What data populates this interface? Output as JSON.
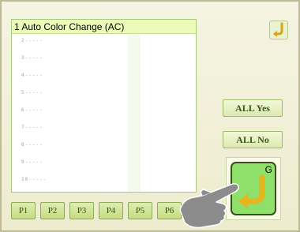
{
  "list": {
    "header": "1 Auto Color Change (AC)",
    "rows": [
      "2-----",
      "3-----",
      "4-----",
      "5-----",
      "6-----",
      "7-----",
      "8-----",
      "9-----",
      "10-----"
    ]
  },
  "buttons": {
    "all_yes": "ALL Yes",
    "all_no": "ALL No",
    "big_g_label": "G"
  },
  "function_keys": [
    "P1",
    "P2",
    "P3",
    "P4",
    "P5",
    "P6"
  ],
  "colors": {
    "accent_green": "#8ee06a",
    "header_bg": "#ecfbb8"
  },
  "icons": {
    "top_right": "yellow-return-arrow-icon",
    "big_button": "yellow-return-arrow-icon",
    "pointer": "pointing-hand-icon"
  }
}
